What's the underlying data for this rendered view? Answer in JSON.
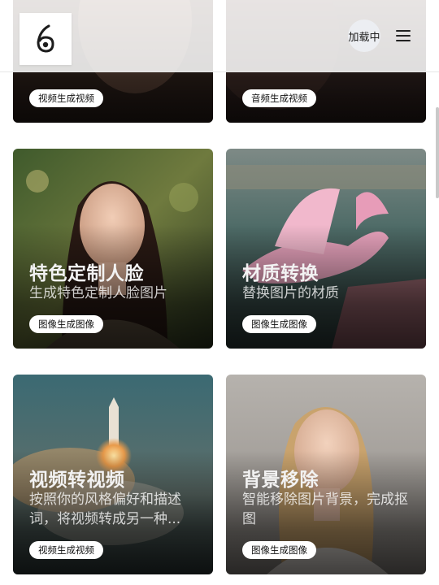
{
  "header": {
    "loading_label": "加载中",
    "menu_icon": "hamburger-menu-icon",
    "logo_icon": "brand-logo-icon"
  },
  "cards": [
    {
      "id": "card-1",
      "title": "",
      "description": "",
      "tag": "视频生成视频",
      "image": "girl-portrait-image"
    },
    {
      "id": "card-2",
      "title": "",
      "description": "",
      "tag": "音频生成视频",
      "image": "portrait-image"
    },
    {
      "id": "card-3",
      "title": "特色定制人脸",
      "description": "生成特色定制人脸图片",
      "tag": "图像生成图像",
      "image": "woman-face-image"
    },
    {
      "id": "card-4",
      "title": "材质转换",
      "description": "替换图片的材质",
      "tag": "图像生成图像",
      "image": "pink-bird-image"
    },
    {
      "id": "card-5",
      "title": "视频转视频",
      "description": "按照你的风格偏好和描述词，将视频转成另一种...",
      "tag": "视频生成视频",
      "image": "rocket-launch-image"
    },
    {
      "id": "card-6",
      "title": "背景移除",
      "description": "智能移除图片背景，完成抠图",
      "tag": "图像生成图像",
      "image": "blonde-woman-image"
    }
  ]
}
